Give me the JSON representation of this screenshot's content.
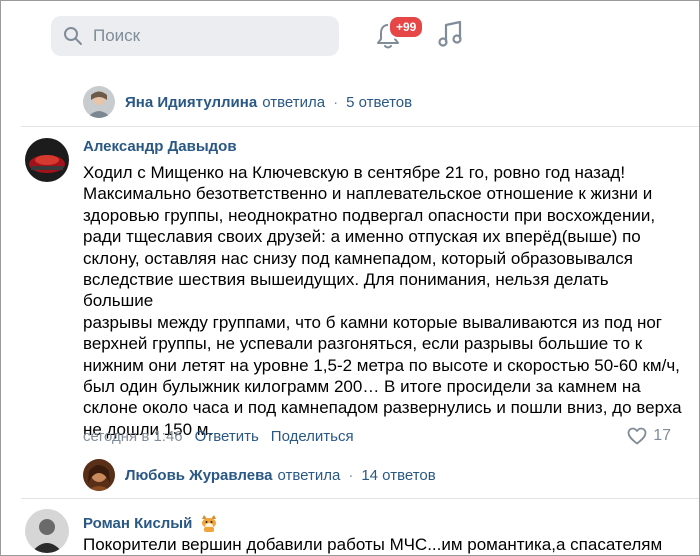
{
  "search": {
    "placeholder": "Поиск"
  },
  "notifications": {
    "badge": "+99"
  },
  "icons": {
    "search": "search-icon",
    "bell": "bell-icon",
    "music": "music-note-icon",
    "heart": "heart-icon",
    "dog": "dog-emoji"
  },
  "colors": {
    "link": "#2a5885",
    "muted": "#818c99",
    "badge": "#e64646",
    "search_bg": "#ebedf0"
  },
  "thread1": {
    "reply_author": "Яна Идиятуллина",
    "reply_verb": "ответила",
    "reply_count": "5 ответов"
  },
  "comment1": {
    "author": "Александр Давыдов",
    "lines": [
      "Ходил с Мищенко на Ключевскую в сентябре 21 го, ровно год назад!",
      "Максимально безответственно и наплевательское отношение к жизни и",
      "здоровью группы, неоднократно подвергал опасности при восхождении,",
      "ради тщеславия своих друзей: а именно отпуская их вперёд(выше) по",
      "склону, оставляя нас снизу под камнепадом, который образовывался",
      "вследствие шествия вышеидущих. Для понимания, нельзя делать большие",
      "разрывы между группами, что б камни которые вываливаются из под ног",
      "верхней группы, не успевали разгоняться, если разрывы большие то к",
      "нижним они летят на уровне 1,5-2 метра по высоте и скоростью 50-60 км/ч,",
      "был один булыжник килограмм 200… В итоге просидели за камнем на",
      "склоне около часа и под камнепадом развернулись и пошли вниз, до верха",
      "не дошли 150 м."
    ],
    "time": "сегодня в 1:46",
    "reply_label": "Ответить",
    "share_label": "Поделиться",
    "likes": "17"
  },
  "thread2": {
    "reply_author": "Любовь Журавлева",
    "reply_verb": "ответила",
    "reply_count": "14 ответов"
  },
  "comment2": {
    "author": "Роман Кислый",
    "text": "Покорители вершин добавили работы МЧС...им романтика,а спасателям"
  }
}
